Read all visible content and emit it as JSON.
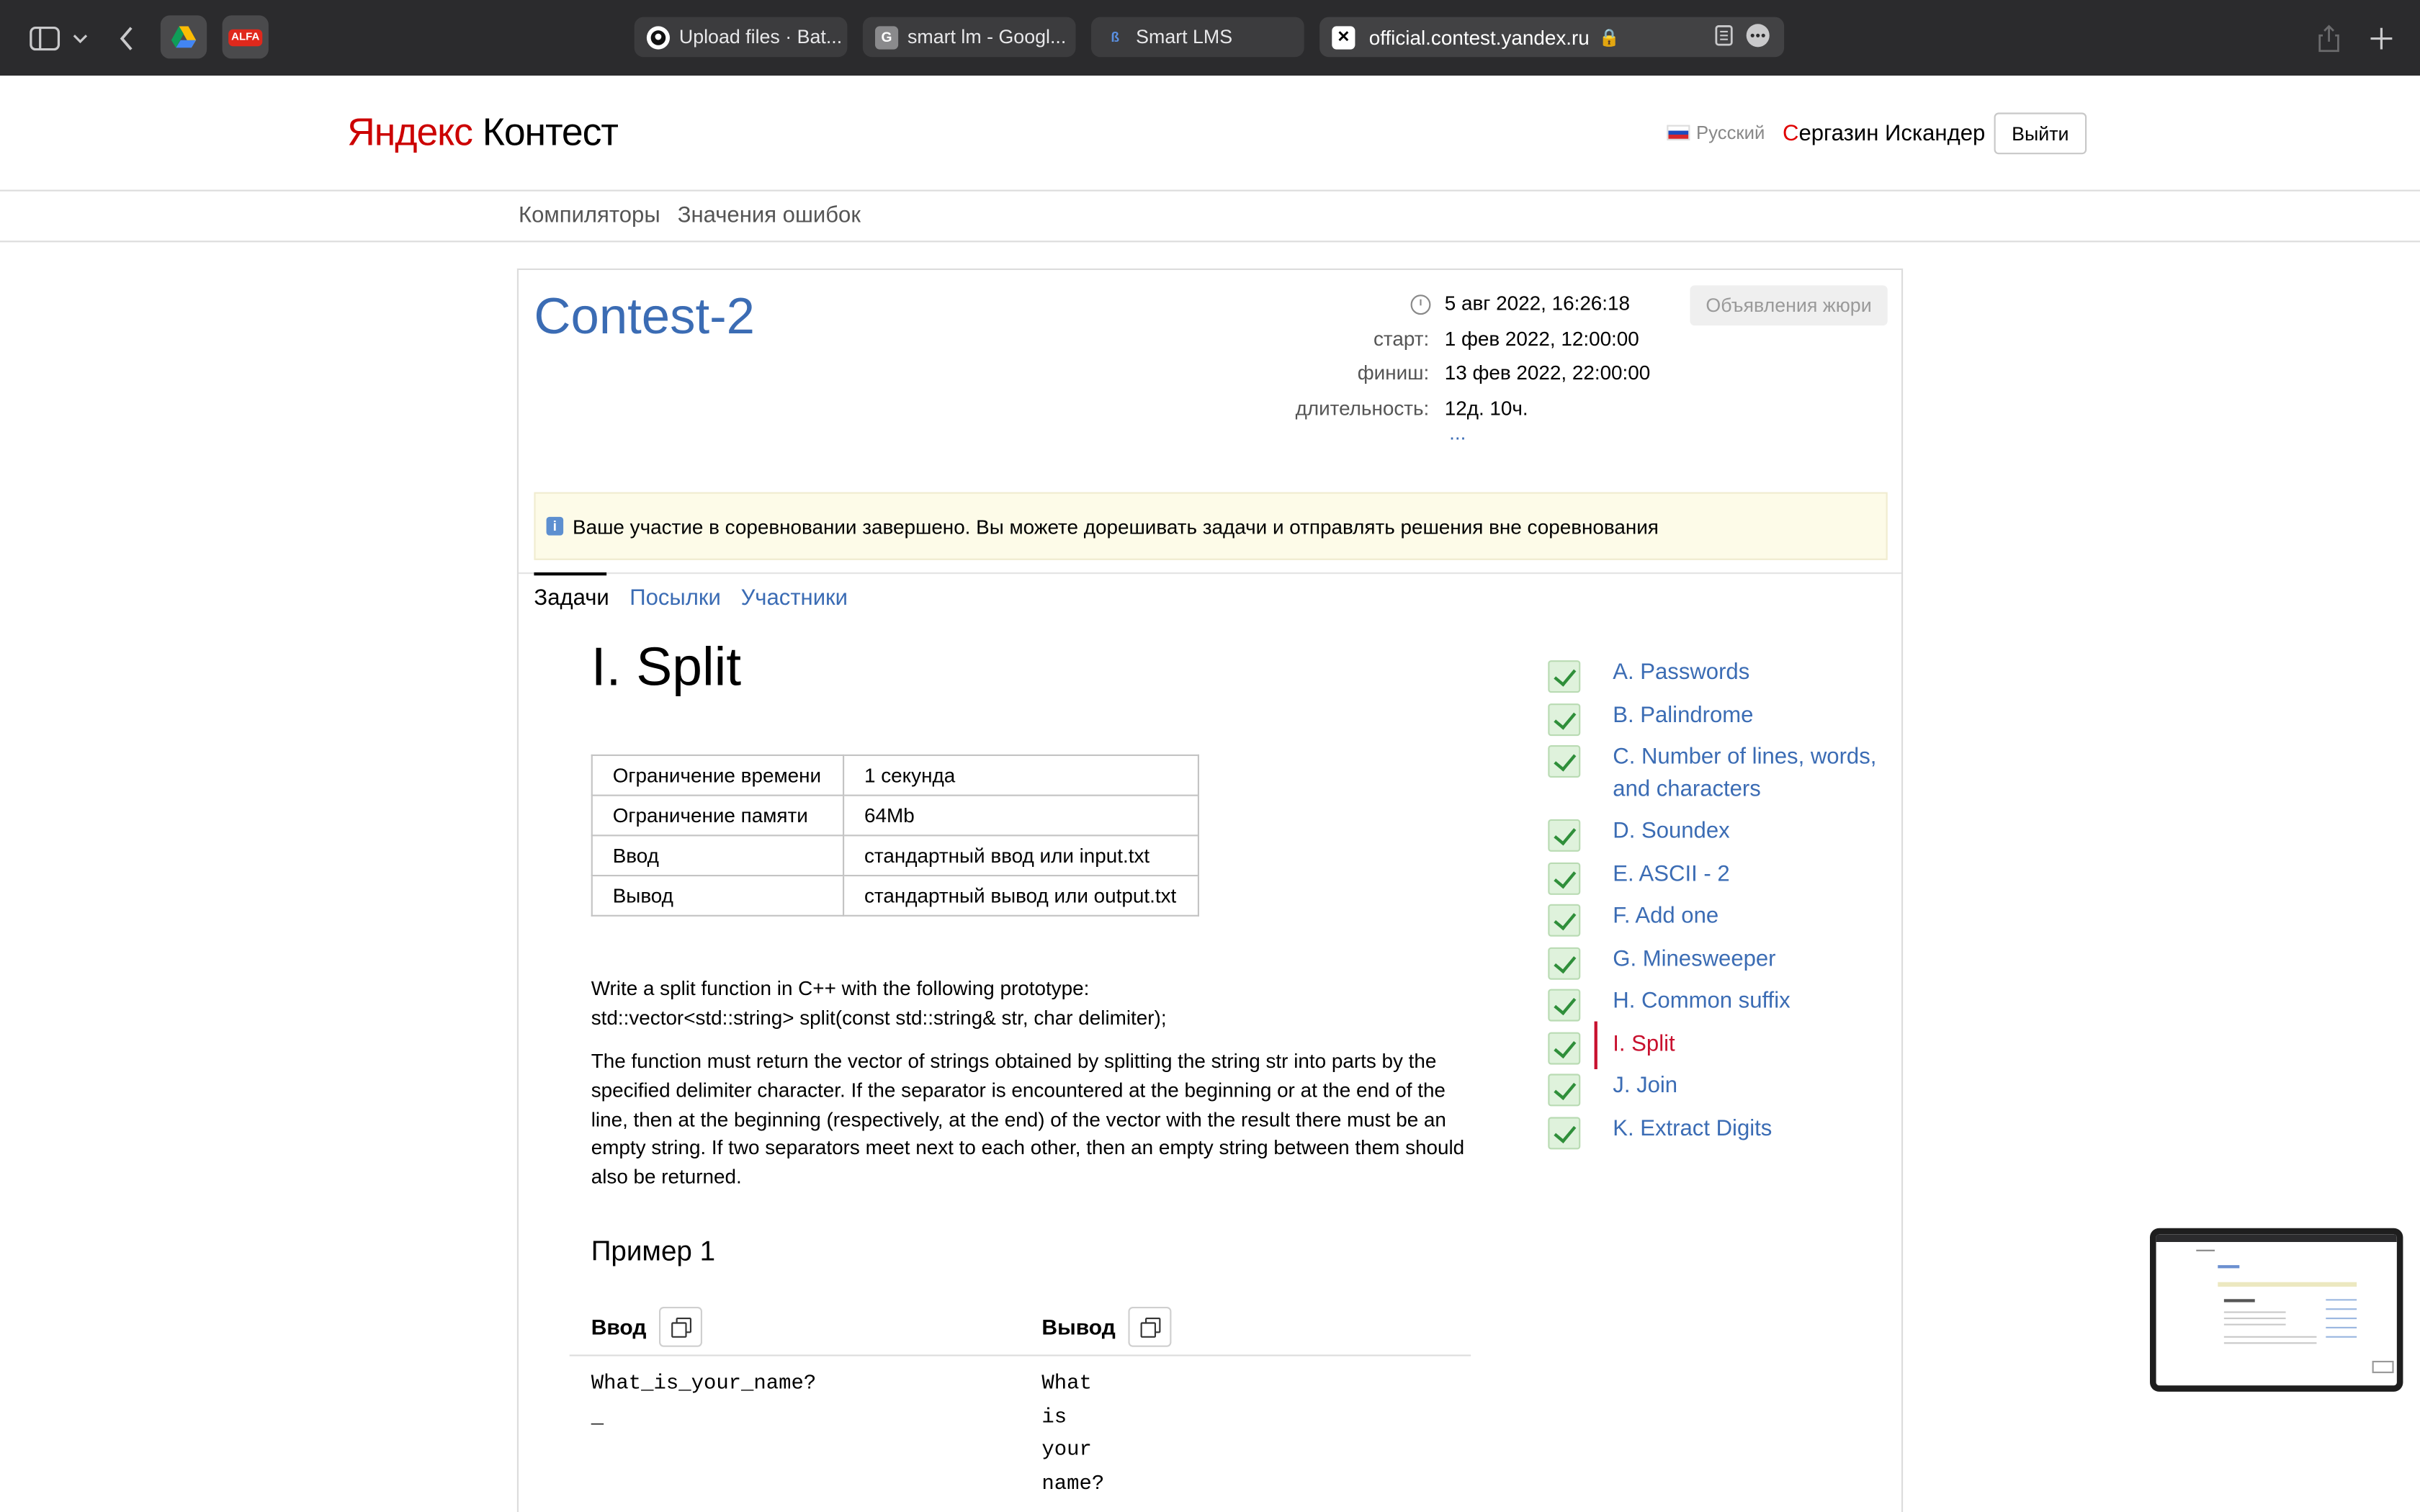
{
  "browser": {
    "tabs": [
      {
        "label": "Upload files · Bat...",
        "favicon": "github-icon"
      },
      {
        "label": "smart lm - Googl...",
        "favicon": "g-icon"
      },
      {
        "label": "Smart LMS",
        "favicon": "lms-icon"
      }
    ],
    "address": "official.contest.yandex.ru",
    "extensions": [
      {
        "name": "google-drive-icon"
      },
      {
        "name": "alfa-icon",
        "label": "ALFA"
      }
    ]
  },
  "header": {
    "logo_ya": "Яндекс",
    "logo_rest": " Контест",
    "language": "Русский",
    "user_first": "С",
    "user_rest": "ергазин Искандер",
    "logout": "Выйти"
  },
  "subnav": [
    "Компиляторы",
    "Значения ошибок"
  ],
  "contest": {
    "title": "Contest-2",
    "now": "5 авг 2022, 16:26:18",
    "start_label": "старт:",
    "start": "1 фев 2022, 12:00:00",
    "finish_label": "финиш:",
    "finish": "13 фев 2022, 22:00:00",
    "duration_label": "длительность:",
    "duration": "12д. 10ч.",
    "more": "...",
    "jury_button": "Объявления жюри",
    "notice": "Ваше участие в соревновании завершено. Вы можете дорешивать задачи и отправлять решения вне соревнования"
  },
  "page_tabs": [
    "Задачи",
    "Посылки",
    "Участники"
  ],
  "problem": {
    "title": "I. Split",
    "limits": [
      {
        "k": "Ограничение времени",
        "v": "1 секунда"
      },
      {
        "k": "Ограничение памяти",
        "v": "64Mb"
      },
      {
        "k": "Ввод",
        "v": "стандартный ввод или input.txt"
      },
      {
        "k": "Вывод",
        "v": "стандартный вывод или output.txt"
      }
    ],
    "statement_1": "Write a split function in C++ with the following prototype:",
    "statement_2": "std::vector<std::string> split(const std::string& str, char delimiter);",
    "statement_3": "The function must return the vector of strings obtained by splitting the string str into parts by the specified delimiter character. If the separator is encountered at the beginning or at the end of the line, then at the beginning (respectively, at the end) of the vector with the result there must be an empty string. If two separators meet next to each other, then an empty string between them should also be returned.",
    "example_title": "Пример 1",
    "input_label": "Ввод",
    "output_label": "Вывод",
    "input_text": "What_is_your_name?\n_",
    "output_text": "What\nis\nyour\nname?"
  },
  "problem_list": [
    {
      "label": "A. Passwords",
      "current": false
    },
    {
      "label": "B. Palindrome",
      "current": false
    },
    {
      "label": "C. Number of lines, words, and characters",
      "current": false
    },
    {
      "label": "D. Soundex",
      "current": false
    },
    {
      "label": "E. ASCII - 2",
      "current": false
    },
    {
      "label": "F. Add one",
      "current": false
    },
    {
      "label": "G. Minesweeper",
      "current": false
    },
    {
      "label": "H. Common suffix",
      "current": false
    },
    {
      "label": "I. Split",
      "current": true
    },
    {
      "label": "J. Join",
      "current": false
    },
    {
      "label": "K. Extract Digits",
      "current": false
    }
  ],
  "colors": {
    "link": "#3b6cb4",
    "current": "#c8102e",
    "accepted": "#2f8f3a"
  }
}
